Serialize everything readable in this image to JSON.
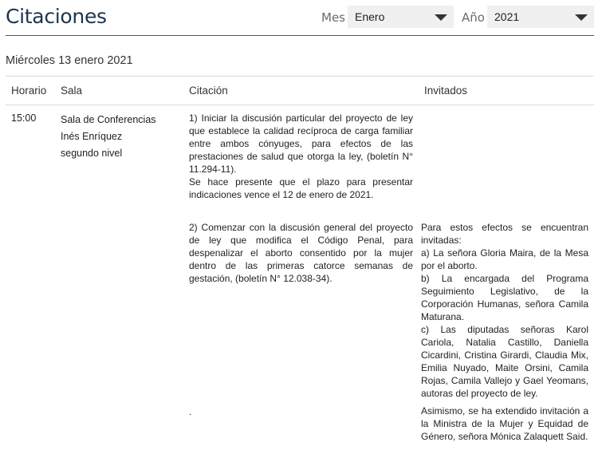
{
  "header": {
    "title": "Citaciones",
    "month_label": "Mes",
    "month_value": "Enero",
    "year_label": "Año",
    "year_value": "2021"
  },
  "day": {
    "heading": "Miércoles 13 enero 2021"
  },
  "table": {
    "columns": [
      "Horario",
      "Sala",
      "Citación",
      "Invitados"
    ],
    "session": {
      "time": "15:00",
      "room_lines": [
        "Sala de Conferencias",
        "Inés Enríquez",
        "segundo nivel"
      ]
    },
    "items": [
      {
        "citation": [
          "1) Iniciar la discusión particular del proyecto de ley que establece la calidad recíproca de carga familiar entre ambos cónyuges, para efectos de las prestaciones de salud que otorga la ley, (boletín N° 11.294-11).",
          "Se hace presente que el plazo para presentar indicaciones vence el 12 de enero de 2021."
        ],
        "guests": []
      },
      {
        "citation": [
          "2) Comenzar con la discusión general del proyecto de ley que modifica el Código Penal, para despenalizar el aborto consentido por la mujer dentro de las primeras catorce semanas de gestación, (boletín N° 12.038-34)."
        ],
        "guests": [
          "Para estos efectos se encuentran invitadas:",
          "a) La señora Gloria Maira, de la Mesa por el aborto.",
          "b) La encargada del Programa Seguimiento Legislativo, de la Corporación Humanas, señora Camila Maturana.",
          "c) Las diputadas señoras Karol Cariola, Natalia Castillo, Daniella Cicardini, Cristina Girardi, Claudia Mix, Emilia Nuyado, Maite Orsini, Camila Rojas, Camila Vallejo y Gael Yeomans, autoras del proyecto de ley."
        ]
      },
      {
        "citation": [
          "."
        ],
        "guests": [
          "Asimismo, se ha extendido invitación a la Ministra de la Mujer y Equidad de Género, señora Mónica Zalaquett Said."
        ]
      }
    ]
  }
}
